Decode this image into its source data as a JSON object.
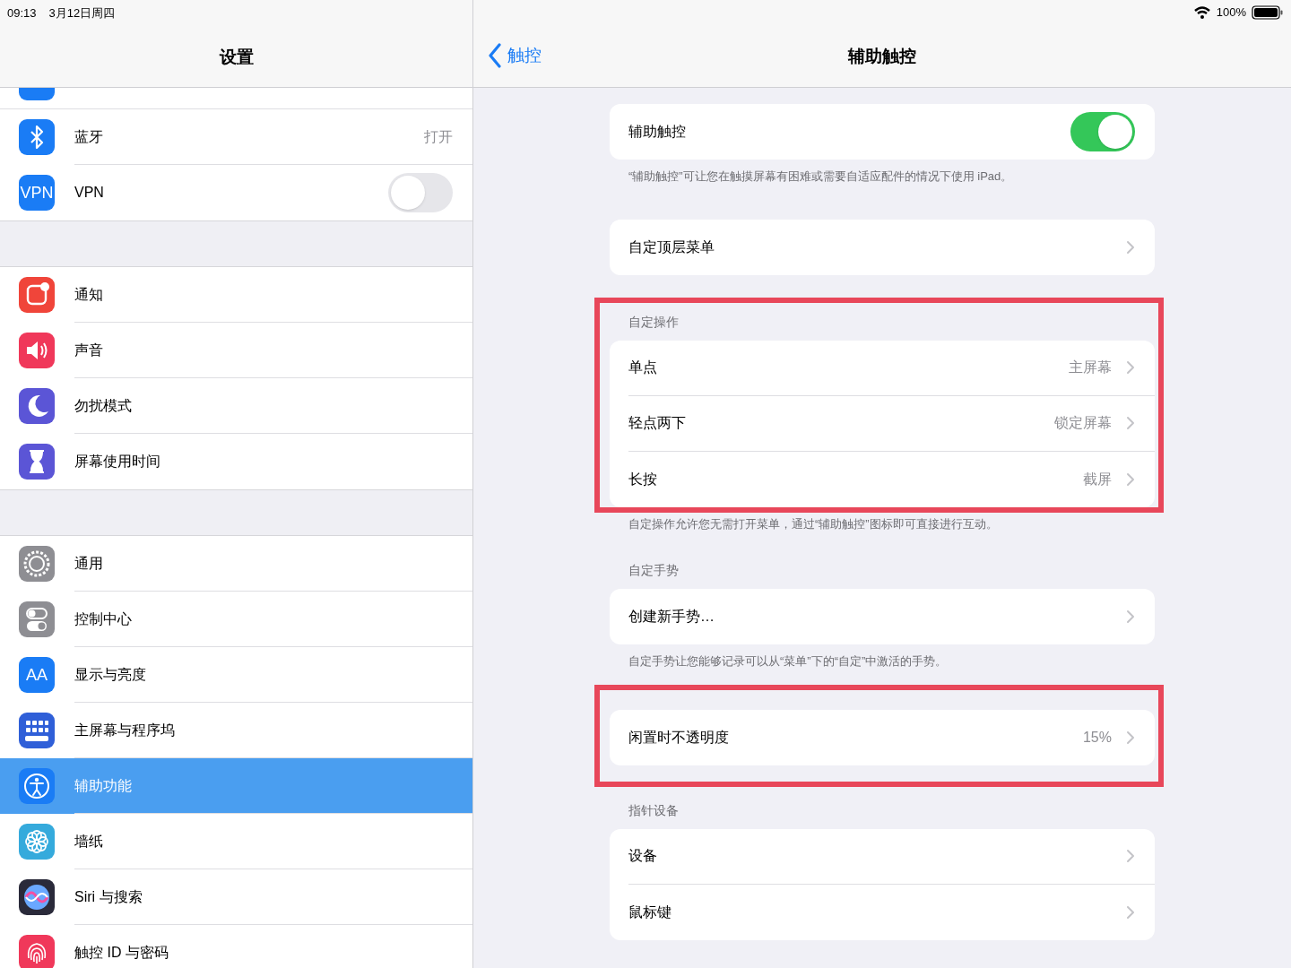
{
  "status_bar": {
    "time": "09:13",
    "date": "3月12日周四",
    "battery": "100%"
  },
  "sidebar": {
    "title": "设置",
    "groups": [
      {
        "items": [
          {
            "label": "蓝牙",
            "kind": "bluetooth",
            "color": "#1a7cf5",
            "value": "打开",
            "selected": false
          },
          {
            "label": "VPN",
            "kind": "vpn",
            "icon_text": "VPN",
            "color": "#1a7cf5",
            "toggle": false,
            "selected": false
          }
        ]
      },
      {
        "items": [
          {
            "label": "通知",
            "kind": "notification",
            "color": "#f0453a",
            "selected": false
          },
          {
            "label": "声音",
            "kind": "sound",
            "color": "#f0385a",
            "selected": false
          },
          {
            "label": "勿扰模式",
            "kind": "moon",
            "color": "#5b55d6",
            "selected": false
          },
          {
            "label": "屏幕使用时间",
            "kind": "hourglass",
            "color": "#5b55d6",
            "selected": false
          }
        ]
      },
      {
        "items": [
          {
            "label": "通用",
            "kind": "gear",
            "color": "#8e8e93",
            "selected": false
          },
          {
            "label": "控制中心",
            "kind": "switches",
            "color": "#8e8e93",
            "selected": false
          },
          {
            "label": "显示与亮度",
            "kind": "text",
            "icon_text": "AA",
            "color": "#1a7cf5",
            "selected": false
          },
          {
            "label": "主屏幕与程序坞",
            "kind": "grid",
            "color": "#2f5fd8",
            "selected": false
          },
          {
            "label": "辅助功能",
            "kind": "person",
            "color": "#1a7cf5",
            "selected": true
          },
          {
            "label": "墙纸",
            "kind": "flower",
            "color": "#35aadc",
            "selected": false
          },
          {
            "label": "Siri 与搜索",
            "kind": "siri",
            "color": "#2a2a3a",
            "selected": false
          },
          {
            "label": "触控 ID 与密码",
            "kind": "fingerprint",
            "color": "#f0385a",
            "selected": false
          }
        ]
      }
    ]
  },
  "detail": {
    "back": "触控",
    "title": "辅助触控",
    "groups": [
      {
        "highlighted": false,
        "rows": [
          {
            "kind": "toggle",
            "label": "辅助触控",
            "on": true
          }
        ],
        "footer": "“辅助触控”可让您在触摸屏幕有困难或需要自适应配件的情况下使用 iPad。"
      },
      {
        "highlighted": false,
        "rows": [
          {
            "kind": "link",
            "label": "自定顶层菜单"
          }
        ]
      },
      {
        "highlighted": true,
        "header": "自定操作",
        "rows": [
          {
            "kind": "link",
            "label": "单点",
            "value": "主屏幕"
          },
          {
            "kind": "link",
            "label": "轻点两下",
            "value": "锁定屏幕"
          },
          {
            "kind": "link",
            "label": "长按",
            "value": "截屏"
          }
        ],
        "footer": "自定操作允许您无需打开菜单，通过“辅助触控”图标即可直接进行互动。"
      },
      {
        "highlighted": false,
        "header": "自定手势",
        "rows": [
          {
            "kind": "link",
            "label": "创建新手势…"
          }
        ],
        "footer": "自定手势让您能够记录可以从“菜单”下的“自定”中激活的手势。"
      },
      {
        "highlighted": true,
        "rows": [
          {
            "kind": "link",
            "label": "闲置时不透明度",
            "value": "15%"
          }
        ]
      },
      {
        "highlighted": false,
        "header": "指针设备",
        "rows": [
          {
            "kind": "link",
            "label": "设备"
          },
          {
            "kind": "link",
            "label": "鼠标键"
          }
        ]
      }
    ]
  }
}
